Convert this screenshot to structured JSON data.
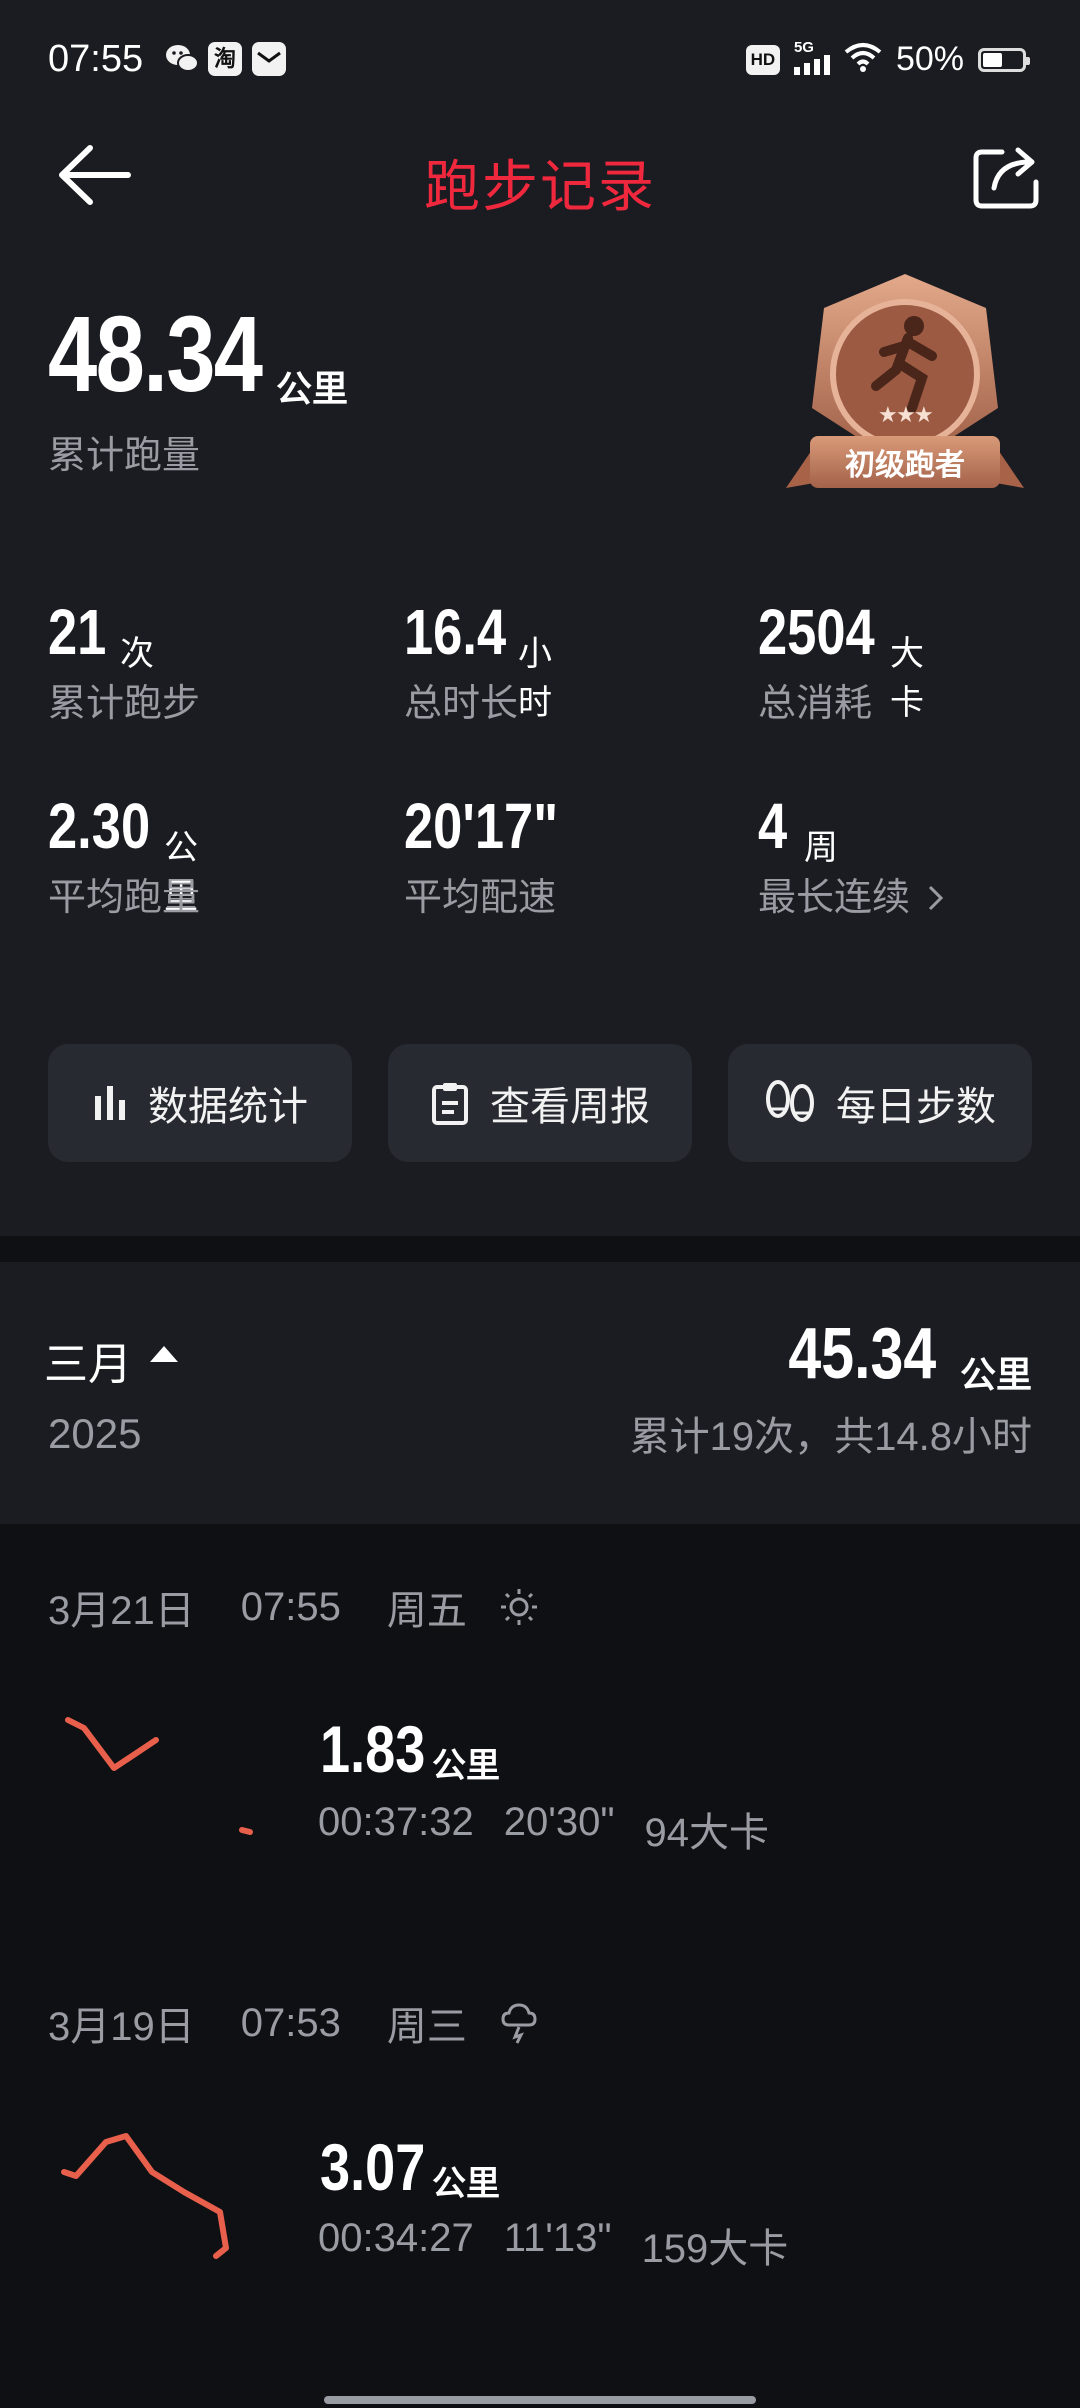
{
  "status_bar": {
    "time": "07:55",
    "app_icons": [
      "wechat-icon",
      "taobao-icon",
      "mail-icon"
    ],
    "taobao_label": "淘",
    "hd_label": "HD",
    "network": "5G",
    "battery_percent_text": "50%",
    "battery_level": 0.5
  },
  "header": {
    "title": "跑步记录",
    "title_color": "#f0283e"
  },
  "summary": {
    "total_distance": "48.34",
    "total_unit": "公里",
    "total_label": "累计跑量",
    "medal_label": "初级跑者"
  },
  "stats": [
    {
      "value": "21",
      "unit": "次",
      "label": "累计跑步"
    },
    {
      "value": "16.4",
      "unit": "小时",
      "label": "总时长"
    },
    {
      "value": "2504",
      "unit": "大卡",
      "label": "总消耗"
    },
    {
      "value": "2.30",
      "unit": "公里",
      "label": "平均跑量"
    },
    {
      "value": "20'17\"",
      "unit": "",
      "label": "平均配速"
    },
    {
      "value": "4",
      "unit": "周",
      "label": "最长连续"
    }
  ],
  "buttons": [
    {
      "label": "数据统计",
      "icon": "bar-chart-icon"
    },
    {
      "label": "查看周报",
      "icon": "clipboard-icon"
    },
    {
      "label": "每日步数",
      "icon": "footprints-icon"
    }
  ],
  "month": {
    "name": "三月",
    "year": "2025",
    "distance": "45.34",
    "unit": "公里",
    "summary": "累计19次，共14.8小时"
  },
  "records": [
    {
      "date": "3月21日",
      "time": "07:55",
      "weekday": "周五",
      "weather_icon": "sun-icon",
      "distance": "1.83",
      "unit": "公里",
      "duration": "00:37:32",
      "pace": "20'30\"",
      "calories": "94大卡"
    },
    {
      "date": "3月19日",
      "time": "07:53",
      "weekday": "周三",
      "weather_icon": "cloud-icon",
      "distance": "3.07",
      "unit": "公里",
      "duration": "00:34:27",
      "pace": "11'13\"",
      "calories": "159大卡"
    }
  ],
  "colors": {
    "accent": "#f0283e",
    "route": "#e8604c",
    "medal": "#c98a6a"
  }
}
